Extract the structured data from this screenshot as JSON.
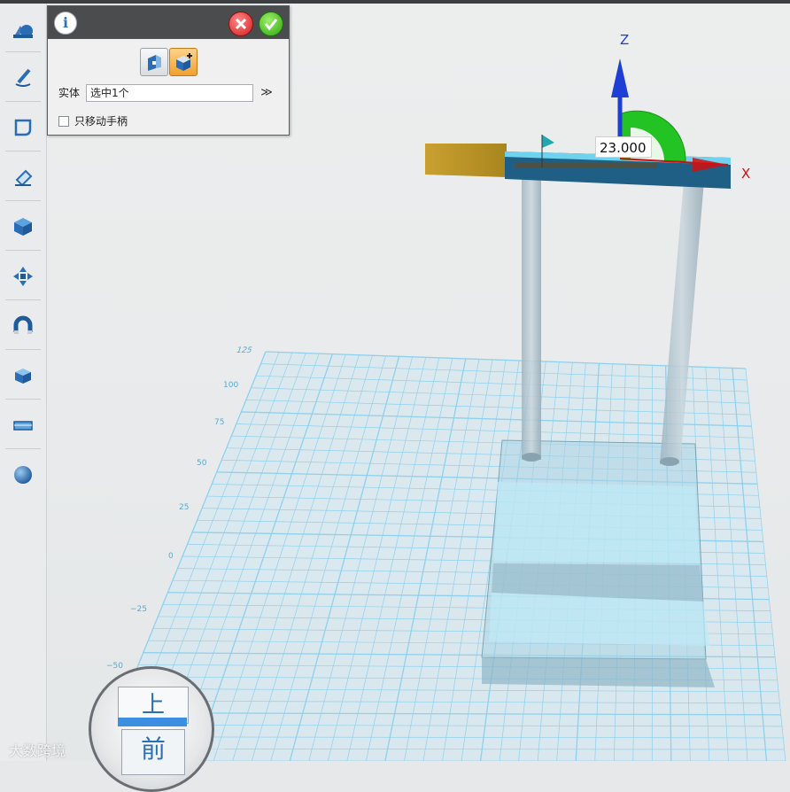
{
  "toolbar": {
    "tools": [
      {
        "name": "sketch-shapes-icon"
      },
      {
        "name": "pen-draw-icon"
      },
      {
        "name": "sketch-edit-icon"
      },
      {
        "name": "eraser-icon"
      },
      {
        "name": "solid-cube-icon"
      },
      {
        "name": "move-arrows-icon"
      },
      {
        "name": "magnet-icon"
      },
      {
        "name": "box-edit-icon"
      },
      {
        "name": "measure-icon"
      },
      {
        "name": "sphere-icon"
      }
    ]
  },
  "panel": {
    "info_icon": "i",
    "entity_label": "实体",
    "entity_value": "选中1个",
    "expand_symbol": "≫",
    "checkbox_label": "只移动手柄",
    "checkbox_checked": false,
    "modes": [
      {
        "name": "move-mode-1-icon",
        "active": false
      },
      {
        "name": "move-mode-2-icon",
        "active": true
      }
    ]
  },
  "viewport": {
    "dimension_value": "23.000",
    "axis_z": "Z",
    "axis_x": "X",
    "grid_labels": [
      "125",
      "100",
      "75",
      "50",
      "25",
      "0",
      "−25",
      "−50"
    ]
  },
  "view_cube": {
    "top_label": "上",
    "front_label": "前"
  },
  "watermark": "大数跨境",
  "colors": {
    "accent_orange": "#f0a030",
    "grid_blue": "#7cc6e8",
    "axis_blue": "#1d3fd6",
    "axis_red": "#d01010",
    "rotate_green": "#1fc01f"
  }
}
